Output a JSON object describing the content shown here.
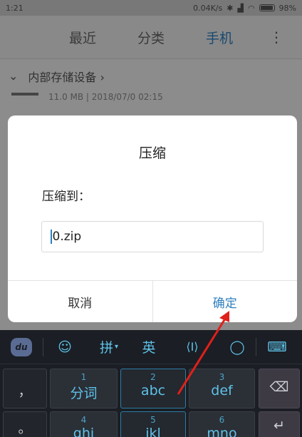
{
  "status": {
    "time": "1:21",
    "speed": "0.04K/s",
    "battery": "98%"
  },
  "tabs": {
    "recent": "最近",
    "category": "分类",
    "phone": "手机",
    "more": "⋮"
  },
  "breadcrumb": {
    "chevron": "⌄",
    "path": "内部存储设备 ›"
  },
  "file": {
    "info": "11.0 MB | 2018/07/0 02:15"
  },
  "dialog": {
    "title": "压缩",
    "label": "压缩到：",
    "filename": "0.zip",
    "cancel": "取消",
    "ok": "确定"
  },
  "keyboard": {
    "logo": "du",
    "emoji": "☺",
    "pinyin": "拼",
    "english": "英",
    "cursor": "⟨I⟩",
    "search": "◯",
    "hide": "⌨",
    "keys": [
      {
        "num": "",
        "main": "，"
      },
      {
        "num": "1",
        "main": "分词"
      },
      {
        "num": "2",
        "main": "abc"
      },
      {
        "num": "3",
        "main": "def"
      },
      {
        "num": "",
        "main": "⌫"
      },
      {
        "num": "",
        "main": "。"
      },
      {
        "num": "4",
        "main": "ghi"
      },
      {
        "num": "5",
        "main": "jkl"
      },
      {
        "num": "6",
        "main": "mno"
      },
      {
        "num": "",
        "main": "↵"
      }
    ]
  },
  "colors": {
    "accent": "#2f7fbf",
    "keyboard_text": "#5ec2e8",
    "annotation": "#e0201a"
  }
}
